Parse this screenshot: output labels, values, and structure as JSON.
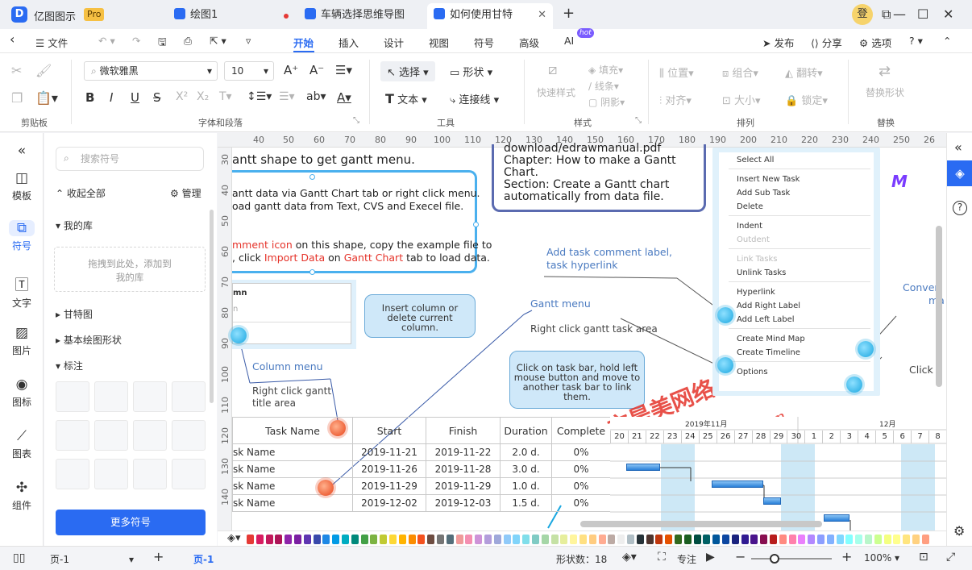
{
  "titlebar": {
    "app_name": "亿图图示",
    "badge": "Pro",
    "avatar": "登",
    "tabs": [
      {
        "label": "绘图1"
      },
      {
        "label": "车辆选择思维导图"
      },
      {
        "label": "如何使用甘特"
      }
    ]
  },
  "menu": {
    "file": "文件",
    "items": [
      "开始",
      "插入",
      "设计",
      "视图",
      "符号",
      "高级",
      "AI"
    ],
    "hot": "hot",
    "publish": "发布",
    "share": "分享",
    "options": "选项"
  },
  "ribbon": {
    "font": "微软雅黑",
    "size": "10",
    "select": "选择",
    "shape": "形状",
    "text": "文本",
    "connector": "连接线",
    "quick_style": "快速样式",
    "fill": "填充",
    "line": "线条",
    "shadow": "阴影",
    "position": "位置",
    "group": "组合",
    "flip": "翻转",
    "align": "对齐",
    "size_label": "大小",
    "lock": "锁定",
    "replace": "替换形状",
    "groups": [
      "剪贴板",
      "字体和段落",
      "工具",
      "样式",
      "排列",
      "替换"
    ]
  },
  "leftbar": [
    "模板",
    "符号",
    "文字",
    "图片",
    "图标",
    "图表",
    "组件"
  ],
  "panel": {
    "search_placeholder": "搜索符号",
    "collapse": "收起全部",
    "manage": "管理",
    "my_lib": "我的库",
    "drop_hint_1": "拖拽到此处，添加到",
    "drop_hint_2": "我的库",
    "gantt": "甘特图",
    "basic": "基本绘图形状",
    "callout": "标注",
    "more": "更多符号"
  },
  "ruler": {
    "top": [
      "40",
      "50",
      "60",
      "70",
      "80",
      "90",
      "100",
      "110",
      "120",
      "130",
      "140",
      "150",
      "160",
      "170",
      "180",
      "190",
      "200",
      "210",
      "220",
      "230",
      "240",
      "250",
      "26"
    ],
    "left": [
      "30",
      "40",
      "50",
      "60",
      "70",
      "80",
      "90",
      "100",
      "110",
      "120",
      "130",
      "140"
    ]
  },
  "canvas": {
    "line1": "antt shape to get gantt menu.",
    "line2": "antt data via Gantt Chart tab or right click menu.",
    "line3": "oad gantt data from Text, CVS and Execel file.",
    "line4a": "mment icon",
    "line4b": " on this shape, copy the example file to",
    "line5a": ", click ",
    "line5b": "Import Data",
    "line5c": " on ",
    "line5d": "Gantt Chart",
    "line5e": " tab to load data.",
    "box_line1": "download/edrawmanual.pdf",
    "box_line2": "Chapter: How to make a Gantt",
    "box_line3": "Chart.",
    "box_line4": "Section: Create a Gantt chart",
    "box_line5": "automatically from data file.",
    "col_hdr": "mn",
    "col_hdr2": "n",
    "callout1": "Insert column or delete current column.",
    "column_menu": "Column menu",
    "right_click_title": "Right click gantt",
    "title_area": "title area",
    "add_comment": "Add task comment label,",
    "hyperlink": "task hyperlink",
    "gantt_menu": "Gantt menu",
    "right_click_task": "Right click gantt task area",
    "callout2": "Click on task bar, hold left mouse button and move to another task bar to link them.",
    "conver": "Conver",
    "ma": "ma",
    "click": "Click",
    "ctx": [
      "Select All",
      "Insert New Task",
      "Add Sub Task",
      "Delete",
      "Indent",
      "Outdent",
      "Link Tasks",
      "Unlink Tasks",
      "Hyperlink",
      "Add Right Label",
      "Add Left Label",
      "Create Mind Map",
      "Create Timeline",
      "Options"
    ],
    "watermark1": "亦是美网络",
    "watermark2": "www.yishimei.cn",
    "table": {
      "headers": [
        "Task Name",
        "Start",
        "Finish",
        "Duration",
        "Complete"
      ],
      "rows": [
        [
          "sk Name",
          "2019-11-21",
          "2019-11-22",
          "2.0 d.",
          "0%"
        ],
        [
          "sk Name",
          "2019-11-26",
          "2019-11-28",
          "3.0 d.",
          "0%"
        ],
        [
          "sk Name",
          "2019-11-29",
          "2019-11-29",
          "1.0 d.",
          "0%"
        ],
        [
          "sk Name",
          "2019-12-02",
          "2019-12-03",
          "1.5 d.",
          "0%"
        ]
      ]
    },
    "month1": "2019年11月",
    "month2": "12月",
    "days": [
      "20",
      "21",
      "22",
      "23",
      "24",
      "25",
      "26",
      "27",
      "28",
      "29",
      "30",
      "1",
      "2",
      "3",
      "4",
      "5",
      "6",
      "7",
      "8"
    ]
  },
  "status": {
    "page": "页-1",
    "page_tab": "页-1",
    "shapes": "形状数：18",
    "focus": "专注",
    "zoom": "100%"
  },
  "colors": {
    "accent": "#2a6bf2"
  }
}
